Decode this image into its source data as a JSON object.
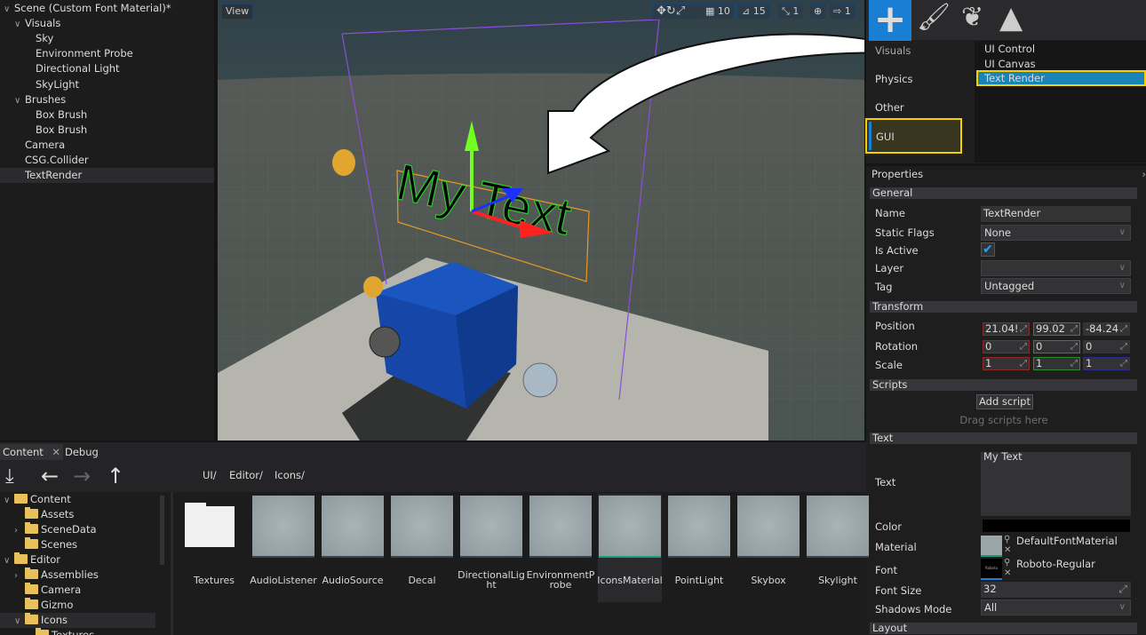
{
  "scene_tree": [
    {
      "label": "Scene (Custom Font Material)*",
      "depth": 0,
      "expanded": true
    },
    {
      "label": "Visuals",
      "depth": 1,
      "expanded": true
    },
    {
      "label": "Sky",
      "depth": 2
    },
    {
      "label": "Environment Probe",
      "depth": 2
    },
    {
      "label": "Directional Light",
      "depth": 2
    },
    {
      "label": "SkyLight",
      "depth": 2
    },
    {
      "label": "Brushes",
      "depth": 1,
      "expanded": true
    },
    {
      "label": "Box Brush",
      "depth": 2
    },
    {
      "label": "Box Brush",
      "depth": 2
    },
    {
      "label": "Camera",
      "depth": 1
    },
    {
      "label": "CSG.Collider",
      "depth": 1
    },
    {
      "label": "TextRender",
      "depth": 1,
      "selected": true
    }
  ],
  "viewport": {
    "view_label": "View",
    "grid_snap": "10",
    "rotate_snap": "15",
    "scale_snap": "1",
    "speed": "1",
    "scene_text": "My Text"
  },
  "toolbox": {
    "tabs": [
      "add-actor",
      "paint",
      "foliage",
      "terrain"
    ],
    "categories": [
      "Visuals",
      "Physics",
      "Other",
      "GUI"
    ],
    "selected_category": "GUI",
    "items": [
      "UI Control",
      "UI Canvas",
      "Text Render"
    ],
    "selected_item": "Text Render",
    "accent": "#1a7fd4",
    "highlight": "#f5d000"
  },
  "properties": {
    "title": "Properties",
    "general": {
      "header": "General",
      "name_label": "Name",
      "name": "TextRender",
      "static_flags_label": "Static Flags",
      "static_flags": "None",
      "is_active_label": "Is Active",
      "is_active": true,
      "layer_label": "Layer",
      "layer": "",
      "tag_label": "Tag",
      "tag": "Untagged"
    },
    "transform": {
      "header": "Transform",
      "position_label": "Position",
      "position": [
        "21.04!",
        "99.02",
        "-84.24"
      ],
      "rotation_label": "Rotation",
      "rotation": [
        "0",
        "0",
        "0"
      ],
      "scale_label": "Scale",
      "scale": [
        "1",
        "1",
        "1"
      ]
    },
    "scripts": {
      "header": "Scripts",
      "add_button": "Add script",
      "hint": "Drag scripts here"
    },
    "text": {
      "header": "Text",
      "text_label": "Text",
      "text": "My Text",
      "color_label": "Color",
      "color": "#000000",
      "material_label": "Material",
      "material": "DefaultFontMaterial",
      "font_label": "Font",
      "font": "Roboto-Regular",
      "font_thumb": "Roboto",
      "font_size_label": "Font Size",
      "font_size": "32",
      "shadows_label": "Shadows Mode",
      "shadows": "All"
    },
    "layout": {
      "header": "Layout"
    }
  },
  "content": {
    "tabs": [
      "Content",
      "Debug"
    ],
    "breadcrumb": [
      "UI/",
      "Editor/",
      "Icons/"
    ],
    "tree": [
      {
        "label": "Content",
        "depth": 0,
        "expanded": true
      },
      {
        "label": "Assets",
        "depth": 1
      },
      {
        "label": "SceneData",
        "depth": 1,
        "collapsed": true
      },
      {
        "label": "Scenes",
        "depth": 1
      },
      {
        "label": "Editor",
        "depth": 0,
        "expanded": true
      },
      {
        "label": "Assemblies",
        "depth": 1,
        "collapsed": true
      },
      {
        "label": "Camera",
        "depth": 1
      },
      {
        "label": "Gizmo",
        "depth": 1
      },
      {
        "label": "Icons",
        "depth": 1,
        "expanded": true,
        "selected": true
      },
      {
        "label": "Textures",
        "depth": 2
      }
    ],
    "assets": [
      {
        "name": "Textures",
        "kind": "folder"
      },
      {
        "name": "AudioListener"
      },
      {
        "name": "AudioSource"
      },
      {
        "name": "Decal"
      },
      {
        "name": "DirectionalLight"
      },
      {
        "name": "EnvironmentProbe"
      },
      {
        "name": "IconsMaterial",
        "selected": true
      },
      {
        "name": "PointLight"
      },
      {
        "name": "Skybox"
      },
      {
        "name": "Skylight"
      }
    ]
  }
}
